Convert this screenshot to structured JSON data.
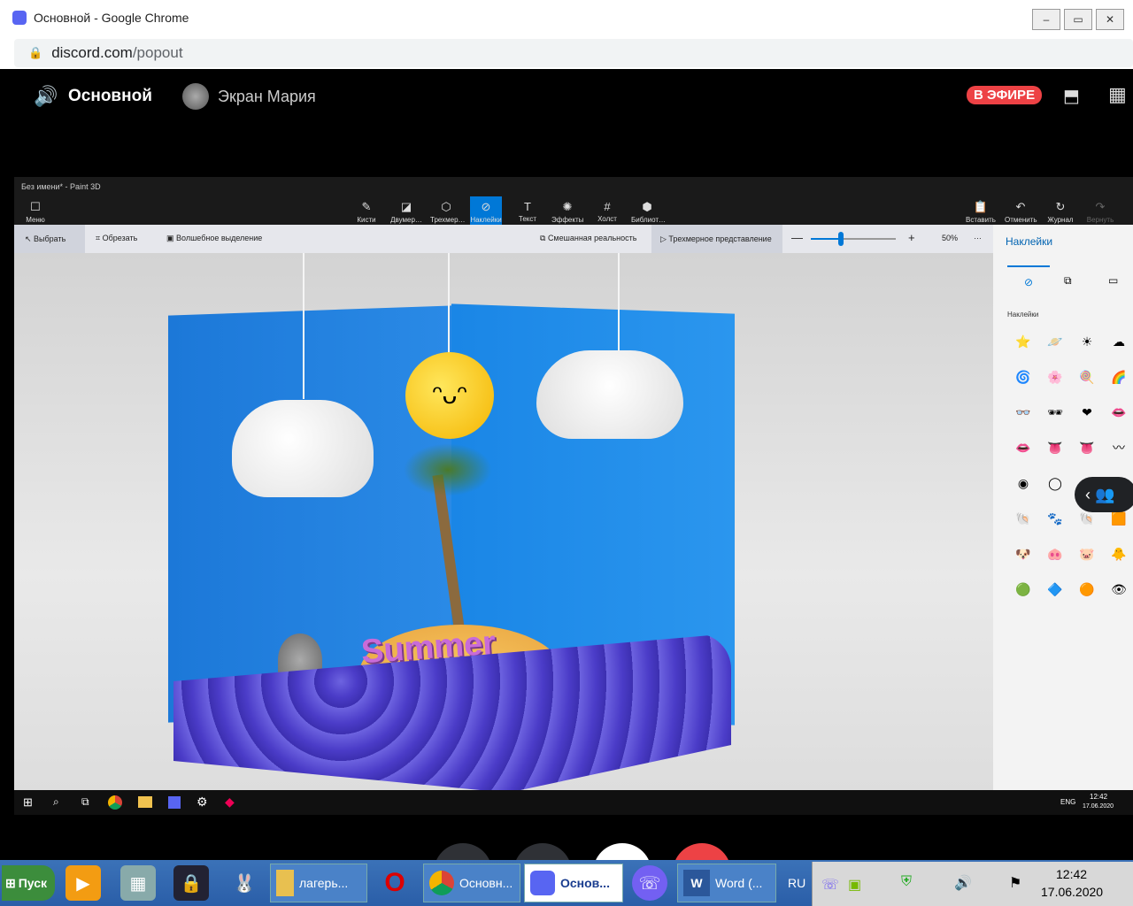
{
  "chrome": {
    "title": "Основной - Google Chrome",
    "url_host": "discord.com",
    "url_path": "/popout",
    "win_min": "–",
    "win_restore": "▭",
    "win_close": "✕"
  },
  "discord": {
    "channel": "Основной",
    "stream_label": "Экран Мария",
    "live_badge": "В ЭФИРЕ"
  },
  "paint": {
    "title": "Без имени* - Paint 3D",
    "menu": "Меню",
    "tools": [
      "Кисти",
      "Двумер…",
      "Трехмер…",
      "Наклейки",
      "Текст",
      "Эффекты",
      "Холст",
      "Библиот…"
    ],
    "actions": [
      "Вставить",
      "Отменить",
      "Журнал",
      "Вернуть"
    ],
    "select": "Выбрать",
    "crop": "Обрезать",
    "magic": "Волшебное выделение",
    "mixed": "Смешанная реальность",
    "view3d": "Трехмерное представление",
    "zoom": "50%",
    "zoom_minus": "—",
    "zoom_plus": "+",
    "more": "…",
    "zoom_level": 0.35,
    "side_title": "Наклейки",
    "side_section": "Наклейки",
    "canvas_word": "Summer",
    "stickers": [
      "⭐",
      "🪐",
      "☀",
      "☁",
      "🌀",
      "🌸",
      "🍭",
      "🌈",
      "👓",
      "🕶",
      "❤",
      "👄",
      "👄",
      "👅",
      "👅",
      "〰",
      "◉",
      "◯",
      "◐",
      "◑",
      "🐚",
      "🐾",
      "🐚",
      "🟧",
      "🐶",
      "🐽",
      "🐷",
      "🐥",
      "🟢",
      "🔷",
      "🟠",
      "👁"
    ],
    "side_tab_icons": [
      "sticker-tab-icon",
      "texture-tab-icon",
      "folder-tab-icon"
    ],
    "accent": "#0078d7"
  },
  "win10_tray": {
    "lang": "ENG",
    "time": "12:42",
    "date": "17.06.2020"
  },
  "xp": {
    "start": "Пуск",
    "buttons": [
      "лагерь...",
      "Основн...",
      "Основ...",
      "Word (..."
    ],
    "lang": "RU",
    "time": "12:42",
    "date": "17.06.2020"
  }
}
